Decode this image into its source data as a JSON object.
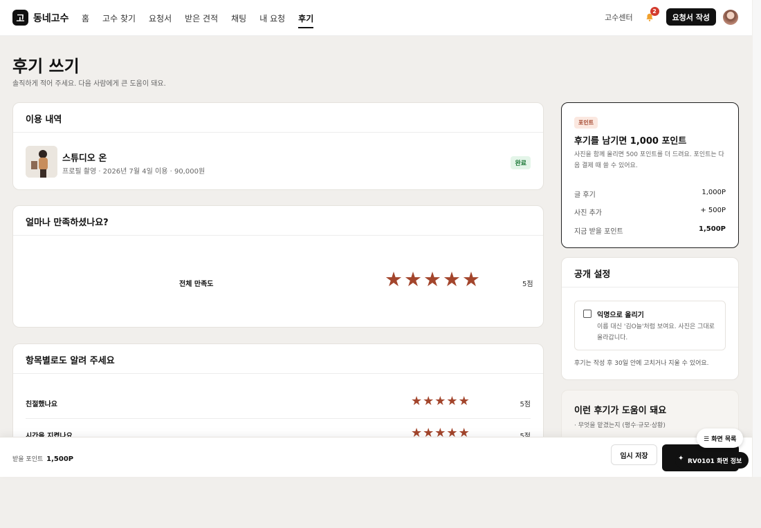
{
  "header": {
    "logo_mark": "고",
    "logo_text": "동네고수",
    "nav": [
      "홈",
      "고수 찾기",
      "요청서",
      "받은 견적",
      "채팅",
      "내 요청",
      "후기"
    ],
    "active_nav": "후기",
    "center_link": "고수센터",
    "notif_count": "2",
    "write_button": "요청서 작성"
  },
  "page": {
    "title": "후기 쓰기",
    "subtitle": "솔직하게 적어 주세요. 다음 사람에게 큰 도움이 돼요."
  },
  "usage": {
    "heading": "이용 내역",
    "name": "스튜디오 온",
    "meta": "프로필 촬영 · 2026년 7월 4일 이용 · 90,000원",
    "status": "완료"
  },
  "satisfaction": {
    "heading": "얼마나 만족하셨나요?",
    "overall_label": "전체 만족도",
    "overall_rating": 5,
    "overall_score": "5점"
  },
  "items": {
    "heading": "항목별로도 알려 주세요",
    "rows": [
      {
        "label": "친절했나요",
        "rating": 5,
        "score": "5점"
      },
      {
        "label": "시간을 지켰나요",
        "rating": 5,
        "score": "5점"
      }
    ]
  },
  "points": {
    "tag": "포인트",
    "title": "후기를 남기면 1,000 포인트",
    "desc": "사진을 함께 올리면 500 포인트를 더 드려요. 포인트는 다음 결제 때 쓸 수 있어요.",
    "rows": [
      {
        "label": "글 후기",
        "value": "1,000P"
      },
      {
        "label": "사진 추가",
        "value": "+ 500P"
      },
      {
        "label": "지금 받을 포인트",
        "value": "1,500P"
      }
    ]
  },
  "public": {
    "heading": "공개 설정",
    "option_title": "익명으로 올리기",
    "option_desc": "이름 대신 '김O늘'처럼 보여요. 사진은 그대로 올라갑니다.",
    "note": "후기는 작성 후 30일 안에 고치거나 지울 수 있어요."
  },
  "tips": {
    "title": "이런 후기가 도움이 돼요",
    "line1": "· 무엇을 맡겼는지 (평수·규모·상황)"
  },
  "bottom": {
    "points_label": "받을 포인트",
    "points_value": "1,500P",
    "draft_button": "임시 저장",
    "screen_list": "☰ 화면 목록",
    "screen_info": "RV0101 화면 정보"
  },
  "colors": {
    "accent": "#a3452c",
    "dark": "#111111",
    "success_bg": "#e4f5e9"
  }
}
